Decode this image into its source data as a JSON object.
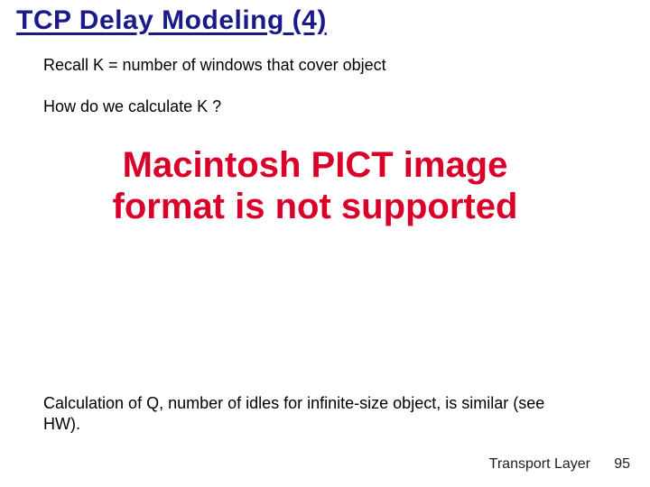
{
  "title": "TCP Delay Modeling (4)",
  "body": {
    "recall_line": "Recall K = number of windows that cover object",
    "question_line": "How do we calculate K ?",
    "pict_error": "Macintosh PICT image format is not supported",
    "calc_line": "Calculation of Q, number  of idles for infinite-size object, is similar (see HW)."
  },
  "footer": {
    "section": "Transport Layer",
    "page_number": "95"
  }
}
